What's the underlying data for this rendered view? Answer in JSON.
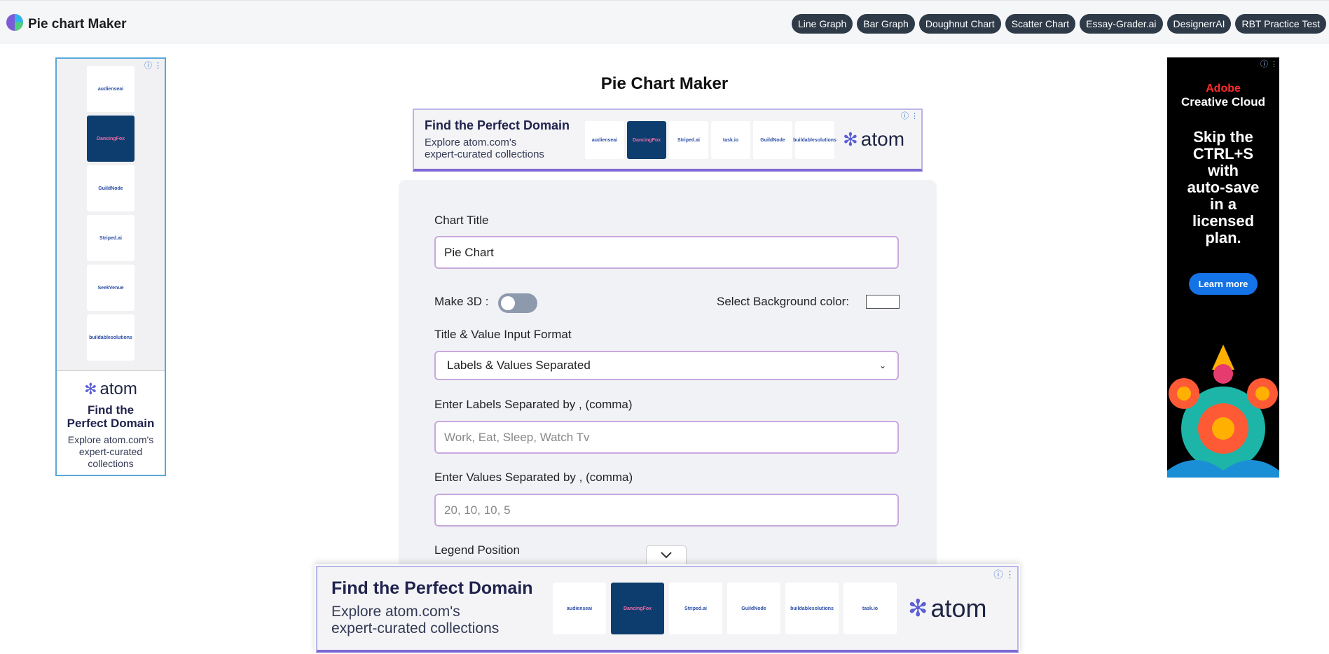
{
  "app": {
    "brand_title": "Pie chart Maker"
  },
  "nav": {
    "items": [
      "Line Graph",
      "Bar Graph",
      "Doughnut Chart",
      "Scatter Chart",
      "Essay-Grader.ai",
      "DesignerrAI",
      "RBT Practice Test"
    ]
  },
  "page": {
    "title": "Pie Chart Maker"
  },
  "ads": {
    "domain_headline": "Find the Perfect Domain",
    "domain_sub1": "Explore atom.com's",
    "domain_sub2": "expert-curated collections",
    "left_headline_1": "Find the",
    "left_headline_2": "Perfect Domain",
    "left_sub_1": "Explore atom.com's",
    "left_sub_2": "expert-curated",
    "left_sub_3": "collections",
    "atom_brand": "atom",
    "tiles": [
      "audienseai",
      "DancingFox",
      "GuildNode",
      "Striped.ai",
      "SeekVenue",
      "buildablesolutions",
      "task.io"
    ],
    "adobe_brand": "Adobe",
    "adobe_product": "Creative Cloud",
    "adobe_line1": "Skip the",
    "adobe_line2": "CTRL+S",
    "adobe_line3": "with",
    "adobe_line4": "auto-save",
    "adobe_line5": "in a",
    "adobe_line6": "licensed",
    "adobe_line7": "plan.",
    "adobe_cta": "Learn more"
  },
  "form": {
    "chart_title_label": "Chart Title",
    "chart_title_value": "Pie Chart",
    "make3d_label": "Make 3D :",
    "make3d_on": false,
    "bg_color_label": "Select Background color:",
    "bg_color_value": "#ffffff",
    "format_label": "Title & Value Input Format",
    "format_selected": "Labels & Values Separated",
    "labels_label": "Enter Labels Separated by , (comma)",
    "labels_placeholder": "Work, Eat, Sleep, Watch Tv",
    "values_label": "Enter Values Separated by , (comma)",
    "values_placeholder": "20, 10, 10, 5",
    "legend_label": "Legend Position"
  },
  "colors": {
    "nav_pill": "#2e3a48",
    "input_border": "#c9a8de",
    "form_bg": "#f0f2f6",
    "atom_purple": "#5b5fd6"
  }
}
